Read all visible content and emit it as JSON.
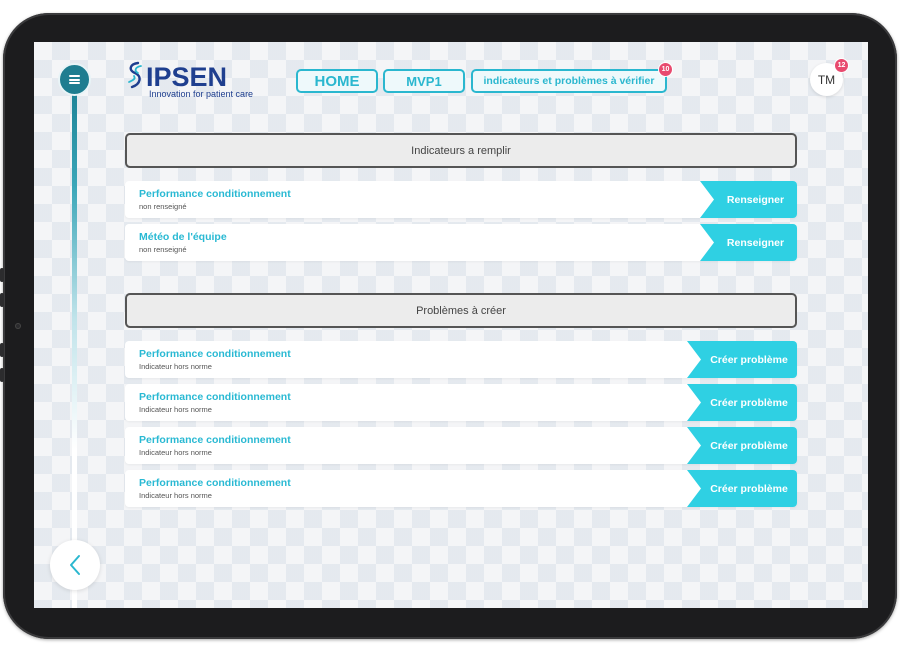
{
  "app": {
    "logo_word": "IPSEN",
    "logo_tagline": "Innovation for patient care",
    "brand_color": "#1f3f8f",
    "accent_color": "#2ab7cf"
  },
  "nav": {
    "home_label": "HOME",
    "mvp_label": "MVP1",
    "check_label": "indicateurs et problèmes à vérifier",
    "check_badge": "10"
  },
  "user": {
    "initials": "TM",
    "badge": "12"
  },
  "indicators": {
    "header": "Indicateurs a remplir",
    "items": [
      {
        "title": "Performance conditionnement",
        "status": "non renseigné",
        "action": "Renseigner"
      },
      {
        "title": "Météo de l'équipe",
        "status": "non renseigné",
        "action": "Renseigner"
      }
    ]
  },
  "problems": {
    "header": "Problèmes à créer",
    "items": [
      {
        "title": "Performance conditionnement",
        "status": "Indicateur hors norme",
        "action": "Créer problème"
      },
      {
        "title": "Performance conditionnement",
        "status": "Indicateur hors norme",
        "action": "Créer problème"
      },
      {
        "title": "Performance conditionnement",
        "status": "Indicateur hors norme",
        "action": "Créer problème"
      },
      {
        "title": "Performance conditionnement",
        "status": "Indicateur hors norme",
        "action": "Créer problème"
      }
    ]
  },
  "icons": {
    "menu": "hamburger-icon",
    "back": "chevron-left-icon",
    "logo": "ipsen-logo-mark"
  }
}
